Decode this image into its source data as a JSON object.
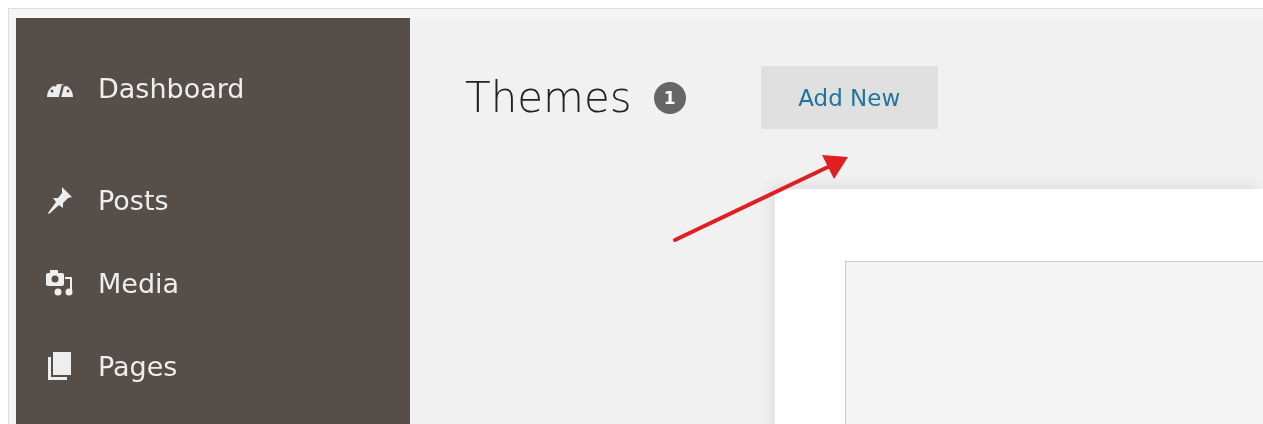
{
  "sidebar": {
    "items": [
      {
        "label": "Dashboard",
        "kind": "dashboard"
      },
      {
        "label": "Posts",
        "kind": "posts"
      },
      {
        "label": "Media",
        "kind": "media"
      },
      {
        "label": "Pages",
        "kind": "pages"
      }
    ]
  },
  "header": {
    "title": "Themes",
    "count": "1",
    "add_button": "Add New"
  }
}
